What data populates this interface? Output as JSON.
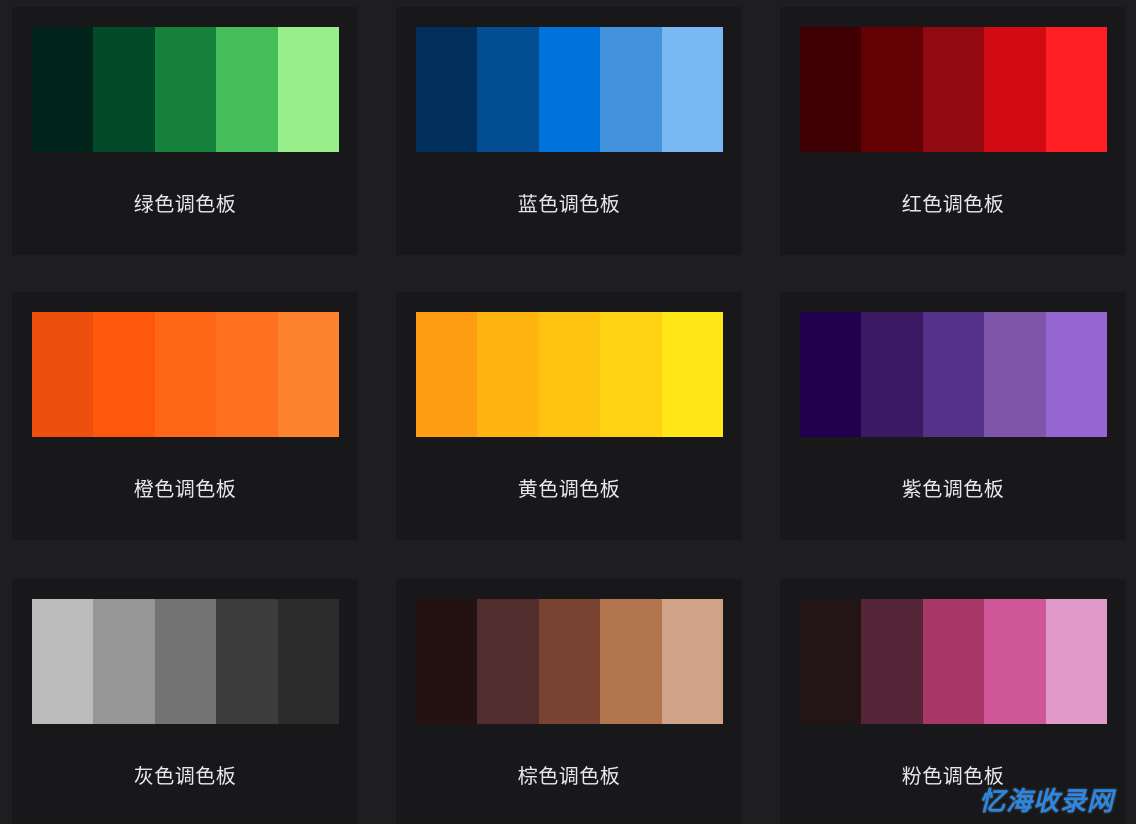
{
  "palettes": [
    {
      "label": "绿色调色板",
      "colors": [
        "#00231a",
        "#034a29",
        "#16813a",
        "#45be5a",
        "#98ee8a"
      ]
    },
    {
      "label": "蓝色调色板",
      "colors": [
        "#002f5b",
        "#034d92",
        "#0073db",
        "#4292dc",
        "#79b8f3"
      ]
    },
    {
      "label": "红色调色板",
      "colors": [
        "#3f0003",
        "#630004",
        "#920a10",
        "#d20b12",
        "#ff1e24"
      ]
    },
    {
      "label": "橙色调色板",
      "colors": [
        "#ec4f0e",
        "#ff580b",
        "#ff6616",
        "#ff7121",
        "#ff822e"
      ]
    },
    {
      "label": "黄色调色板",
      "colors": [
        "#ff9e12",
        "#ffb50f",
        "#ffc412",
        "#ffd313",
        "#ffe616"
      ]
    },
    {
      "label": "紫色调色板",
      "colors": [
        "#210050",
        "#3b1a63",
        "#553289",
        "#7f55aa",
        "#9566d2"
      ]
    },
    {
      "label": "灰色调色板",
      "colors": [
        "#bcbcbc",
        "#969696",
        "#737373",
        "#3c3c3c",
        "#2c2c2c"
      ]
    },
    {
      "label": "棕色调色板",
      "colors": [
        "#241112",
        "#512d2d",
        "#784330",
        "#b3754e",
        "#d0a288"
      ]
    },
    {
      "label": "粉色调色板",
      "colors": [
        "#231416",
        "#562537",
        "#a73766",
        "#cf5799",
        "#e09ac9"
      ]
    }
  ],
  "watermark": "忆海收录网"
}
